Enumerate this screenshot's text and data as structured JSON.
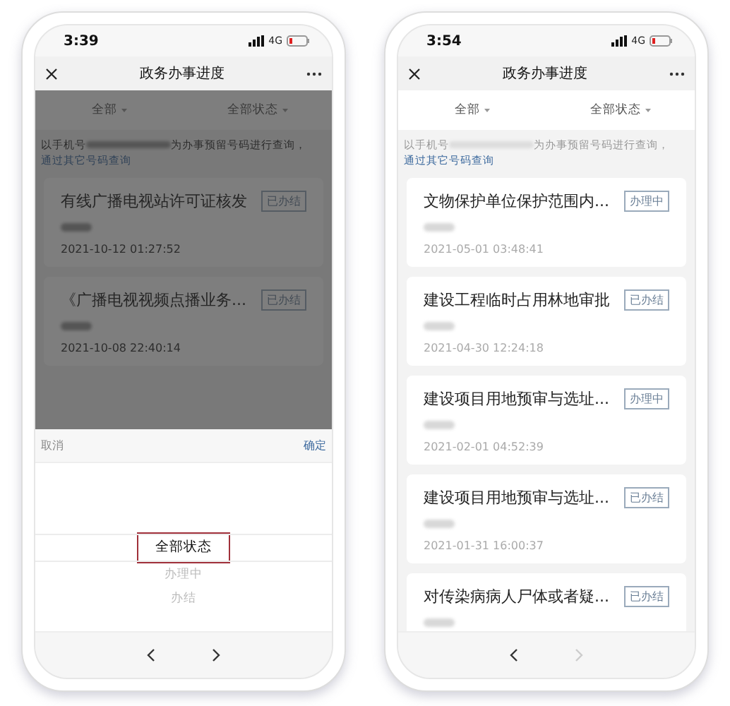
{
  "phones": [
    {
      "time": "3:39",
      "network": "4G",
      "title": "政务办事进度",
      "filters": [
        {
          "label": "全部"
        },
        {
          "label": "全部状态"
        }
      ],
      "notice": {
        "before": "以手机号",
        "after": "为办事预留号码进行查询，",
        "link": "通过其它号码查询"
      },
      "items": [
        {
          "title": "有线广播电视站许可证核发",
          "status": "已办结",
          "date": "2021-10-12 01:27:52"
        },
        {
          "title": "《广播电视视频点播业务...",
          "status": "已办结",
          "date": "2021-10-08 22:40:14"
        }
      ],
      "picker": {
        "cancel": "取消",
        "confirm": "确定",
        "options": [
          {
            "label": "全部状态",
            "selected": true
          },
          {
            "label": "办理中",
            "selected": false
          },
          {
            "label": "办结",
            "selected": false
          }
        ]
      },
      "nav": {
        "back_disabled": false,
        "forward_disabled": false
      }
    },
    {
      "time": "3:54",
      "network": "4G",
      "title": "政务办事进度",
      "filters": [
        {
          "label": "全部"
        },
        {
          "label": "全部状态"
        }
      ],
      "notice": {
        "before": "以手机号",
        "after": "为办事预留号码进行查询，",
        "link": "通过其它号码查询"
      },
      "items": [
        {
          "title": "文物保护单位保护范围内...",
          "status": "办理中",
          "date": "2021-05-01 03:48:41"
        },
        {
          "title": "建设工程临时占用林地审批",
          "status": "已办结",
          "date": "2021-04-30 12:24:18"
        },
        {
          "title": "建设项目用地预审与选址...",
          "status": "办理中",
          "date": "2021-02-01 04:52:39"
        },
        {
          "title": "建设项目用地预审与选址...",
          "status": "已办结",
          "date": "2021-01-31 16:00:37"
        },
        {
          "title": "对传染病病人尸体或者疑...",
          "status": "已办结"
        }
      ],
      "nav": {
        "back_disabled": false,
        "forward_disabled": true
      }
    }
  ]
}
